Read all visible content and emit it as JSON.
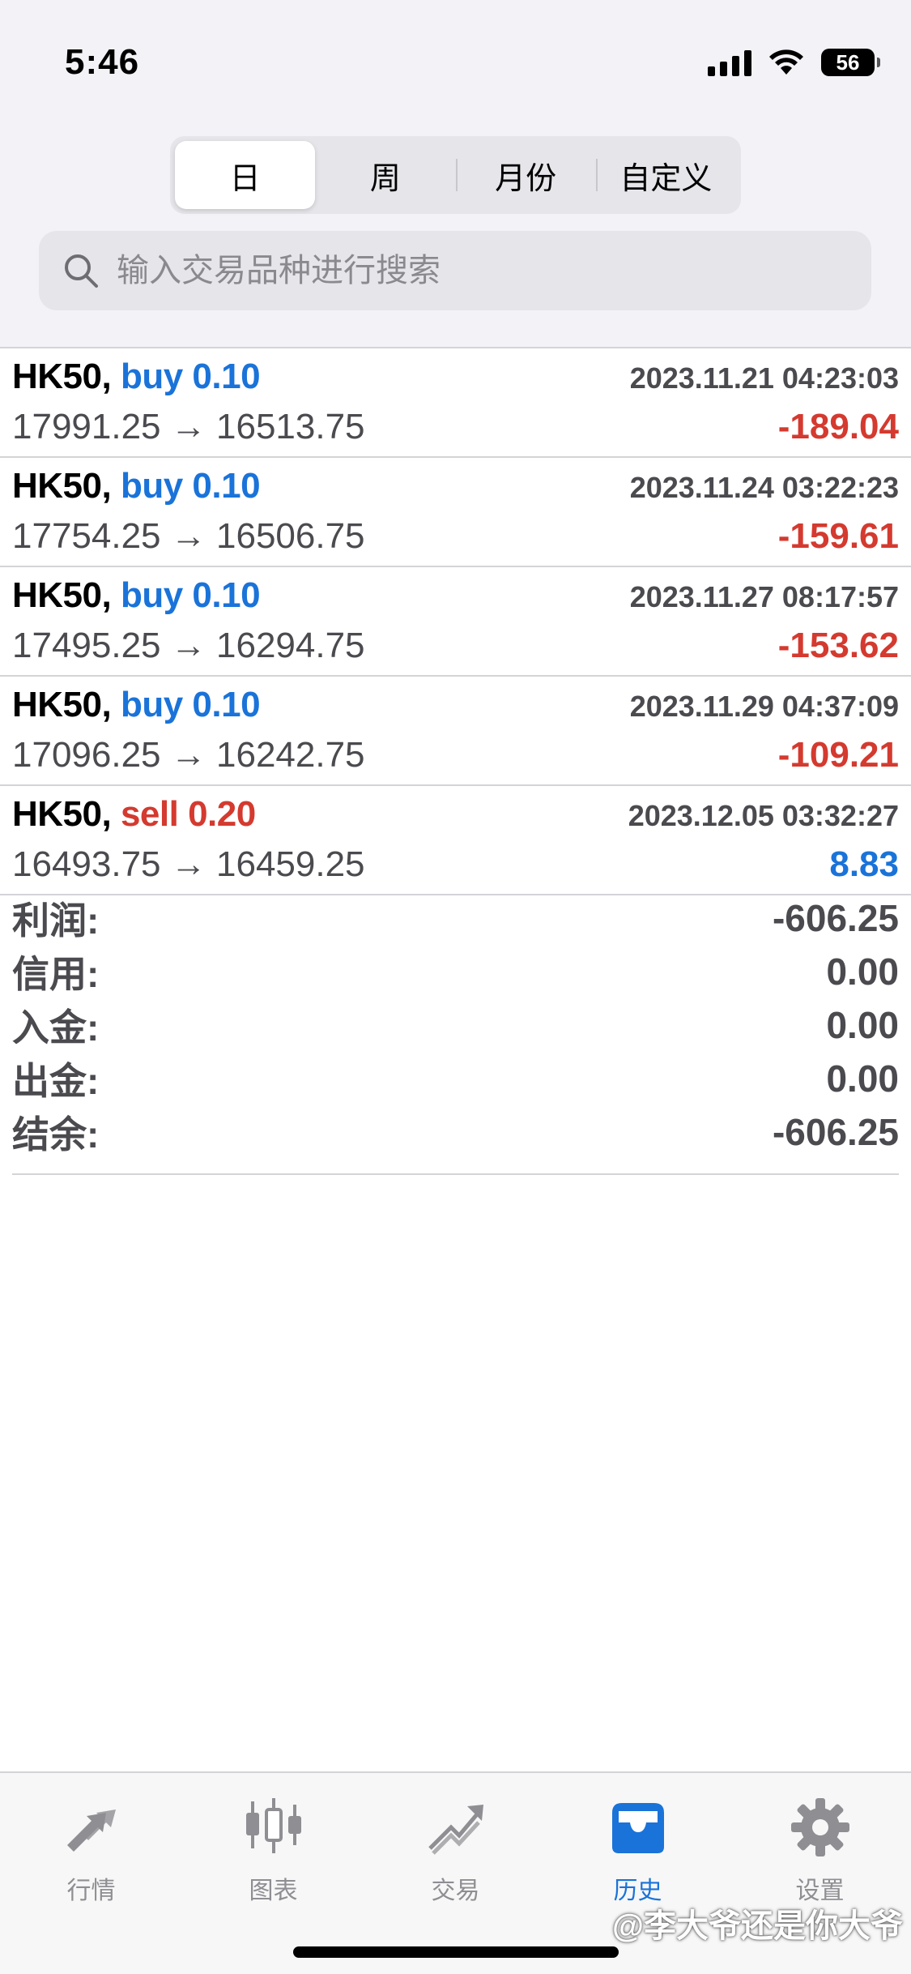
{
  "status_bar": {
    "time": "5:46",
    "battery": "56"
  },
  "segments": [
    {
      "label": "日",
      "active": true
    },
    {
      "label": "周",
      "active": false
    },
    {
      "label": "月份",
      "active": false
    },
    {
      "label": "自定义",
      "active": false
    }
  ],
  "search": {
    "placeholder": "输入交易品种进行搜索"
  },
  "deals": [
    {
      "symbol": "HK50,",
      "side": "buy",
      "volume": "0.10",
      "time": "2023.11.21 04:23:03",
      "open": "17991.25",
      "close": "16513.75",
      "arrow": "→",
      "profit": "-189.04"
    },
    {
      "symbol": "HK50,",
      "side": "buy",
      "volume": "0.10",
      "time": "2023.11.24 03:22:23",
      "open": "17754.25",
      "close": "16506.75",
      "arrow": "→",
      "profit": "-159.61"
    },
    {
      "symbol": "HK50,",
      "side": "buy",
      "volume": "0.10",
      "time": "2023.11.27 08:17:57",
      "open": "17495.25",
      "close": "16294.75",
      "arrow": "→",
      "profit": "-153.62"
    },
    {
      "symbol": "HK50,",
      "side": "buy",
      "volume": "0.10",
      "time": "2023.11.29 04:37:09",
      "open": "17096.25",
      "close": "16242.75",
      "arrow": "→",
      "profit": "-109.21"
    },
    {
      "symbol": "HK50,",
      "side": "sell",
      "volume": "0.20",
      "time": "2023.12.05 03:32:27",
      "open": "16493.75",
      "close": "16459.25",
      "arrow": "→",
      "profit": "8.83"
    }
  ],
  "summary": [
    {
      "label": "利润:",
      "value": "-606.25"
    },
    {
      "label": "信用:",
      "value": "0.00"
    },
    {
      "label": "入金:",
      "value": "0.00"
    },
    {
      "label": "出金:",
      "value": "0.00"
    },
    {
      "label": "结余:",
      "value": "-606.25"
    }
  ],
  "tabs": [
    {
      "label": "行情",
      "icon": "quotes-arrows-icon",
      "active": false
    },
    {
      "label": "图表",
      "icon": "candlestick-chart-icon",
      "active": false
    },
    {
      "label": "交易",
      "icon": "trade-trend-icon",
      "active": false
    },
    {
      "label": "历史",
      "icon": "history-inbox-icon",
      "active": true
    },
    {
      "label": "设置",
      "icon": "gear-icon",
      "active": false
    }
  ],
  "watermark": "@李大爷还是你大爷",
  "colors": {
    "accent_blue": "#1a73d9",
    "loss_red": "#d43a2f",
    "muted_gray": "#8e8e93"
  }
}
